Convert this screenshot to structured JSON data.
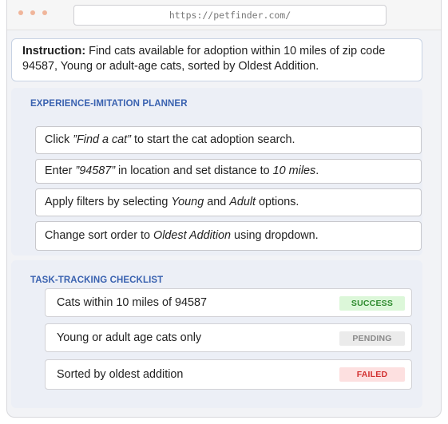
{
  "browser": {
    "url": "https://petfinder.com/"
  },
  "instruction": {
    "label": "Instruction:",
    "text": "Find cats available for adoption within 10 miles of zip code 94587, Young or adult-age cats, sorted by Oldest Addition."
  },
  "planner": {
    "title": "EXPERIENCE-IMITATION PLANNER",
    "steps": [
      {
        "pre": "Click ",
        "em": "”Find a cat”",
        "post": " to start the cat adoption search."
      },
      {
        "pre": "Enter ",
        "em": "”94587”",
        "mid": " in location and set distance to ",
        "em2": "10 miles",
        "post": "."
      },
      {
        "pre": "Apply filters by selecting ",
        "em": "Young",
        "mid": " and ",
        "em2": "Adult",
        "post": " options."
      },
      {
        "pre": "Change sort order to ",
        "em": "Oldest Addition",
        "post": " using dropdown."
      }
    ]
  },
  "checklist": {
    "title": "TASK-TRACKING CHECKLIST",
    "items": [
      {
        "label": "Cats within 10 miles of 94587",
        "status": "SUCCESS"
      },
      {
        "label": "Young or adult age cats only",
        "status": "PENDING"
      },
      {
        "label": "Sorted by oldest addition",
        "status": "FAILED"
      }
    ]
  },
  "colors": {
    "accent": "#3a62b0",
    "success": "#2e8b2e",
    "pending": "#8a8a8a",
    "failed": "#d23030"
  }
}
